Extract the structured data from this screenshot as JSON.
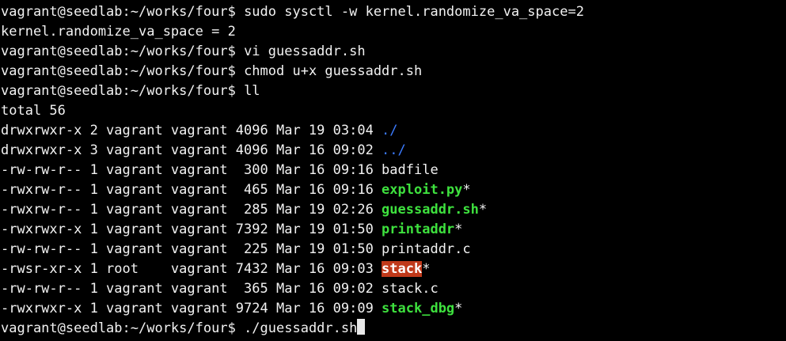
{
  "prompt": "vagrant@seedlab:~/works/four$",
  "session": [
    {
      "kind": "command",
      "command": "sudo sysctl -w kernel.randomize_va_space=2"
    },
    {
      "kind": "output",
      "text": "kernel.randomize_va_space = 2"
    },
    {
      "kind": "command",
      "command": "vi guessaddr.sh"
    },
    {
      "kind": "command",
      "command": "chmod u+x guessaddr.sh"
    },
    {
      "kind": "command",
      "command": "ll"
    },
    {
      "kind": "output",
      "text": "total 56"
    }
  ],
  "listing": [
    {
      "info": "drwxrwxr-x 2 vagrant vagrant 4096 Mar 19 03:04 ",
      "name": "./",
      "type": "dir",
      "suffix": ""
    },
    {
      "info": "drwxrwxr-x 3 vagrant vagrant 4096 Mar 16 09:02 ",
      "name": "../",
      "type": "dir",
      "suffix": ""
    },
    {
      "info": "-rw-rw-r-- 1 vagrant vagrant  300 Mar 16 09:16 ",
      "name": "badfile",
      "type": "file",
      "suffix": ""
    },
    {
      "info": "-rwxrw-r-- 1 vagrant vagrant  465 Mar 16 09:16 ",
      "name": "exploit.py",
      "type": "exec",
      "suffix": "*"
    },
    {
      "info": "-rwxrw-r-- 1 vagrant vagrant  285 Mar 19 02:26 ",
      "name": "guessaddr.sh",
      "type": "exec",
      "suffix": "*"
    },
    {
      "info": "-rwxrwxr-x 1 vagrant vagrant 7392 Mar 19 01:50 ",
      "name": "printaddr",
      "type": "exec",
      "suffix": "*"
    },
    {
      "info": "-rw-rw-r-- 1 vagrant vagrant  225 Mar 19 01:50 ",
      "name": "printaddr.c",
      "type": "file",
      "suffix": ""
    },
    {
      "info": "-rwsr-xr-x 1 root    vagrant 7432 Mar 16 09:03 ",
      "name": "stack",
      "type": "setuid",
      "suffix": "*"
    },
    {
      "info": "-rw-rw-r-- 1 vagrant vagrant  365 Mar 16 09:02 ",
      "name": "stack.c",
      "type": "file",
      "suffix": ""
    },
    {
      "info": "-rwxrwxr-x 1 vagrant vagrant 9724 Mar 16 09:09 ",
      "name": "stack_dbg",
      "type": "exec",
      "suffix": "*"
    }
  ],
  "current_input": "./guessaddr.sh",
  "colors": {
    "background": "#000000",
    "foreground": "#f2f2f2",
    "directory": "#3b7bff",
    "executable": "#3ee13e",
    "setuid_bg": "#c0391a"
  }
}
